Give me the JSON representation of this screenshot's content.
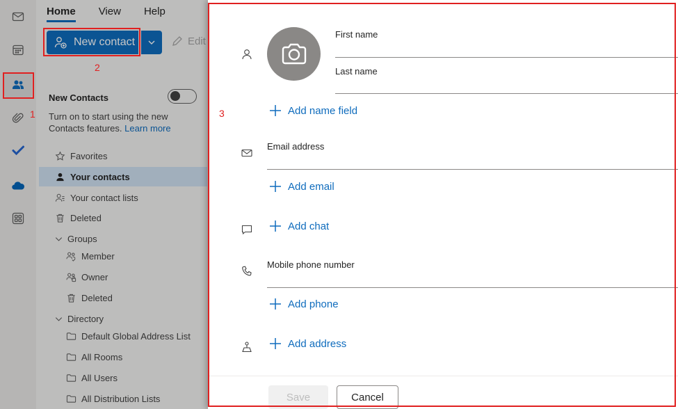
{
  "ribbon": {
    "tabs": [
      {
        "label": "Home",
        "active": true
      },
      {
        "label": "View",
        "active": false
      },
      {
        "label": "Help",
        "active": false
      }
    ],
    "new_contact_label": "New contact",
    "edit_label": "Edit"
  },
  "new_contacts": {
    "title": "New Contacts",
    "toggle_on": false,
    "description": "Turn on to start using the new Contacts features.",
    "learn_more": "Learn more"
  },
  "nav": {
    "favorites": "Favorites",
    "your_contacts": "Your contacts",
    "contact_lists": "Your contact lists",
    "deleted": "Deleted",
    "groups": "Groups",
    "member": "Member",
    "owner": "Owner",
    "groups_deleted": "Deleted",
    "directory": "Directory",
    "gal": "Default Global Address List",
    "rooms": "All Rooms",
    "users": "All Users",
    "distribution": "All Distribution Lists"
  },
  "annotations": {
    "one": "1",
    "two": "2",
    "three": "3"
  },
  "panel": {
    "first_name": "First name",
    "last_name": "Last name",
    "add_name_field": "Add name field",
    "email_label": "Email address",
    "add_email": "Add email",
    "add_chat": "Add chat",
    "mobile_label": "Mobile phone number",
    "add_phone": "Add phone",
    "add_address": "Add address",
    "save": "Save",
    "cancel": "Cancel"
  },
  "colors": {
    "accent": "#0f6cbd",
    "annotation": "#e02020"
  }
}
